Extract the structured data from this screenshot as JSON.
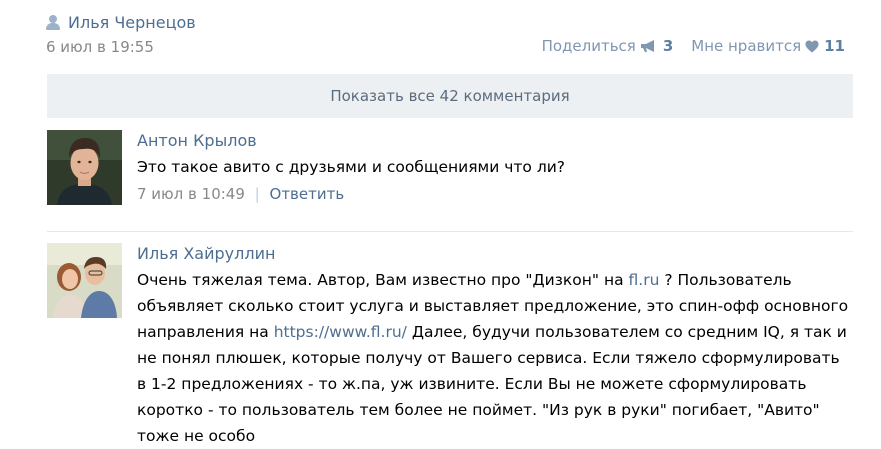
{
  "post": {
    "author": "Илья Чернецов",
    "date": "6 июл в 19:55",
    "share_label": "Поделиться",
    "share_count": "3",
    "like_label": "Мне нравится",
    "like_count": "11"
  },
  "show_all_label": "Показать все 42 комментария",
  "comments": [
    {
      "author": "Антон Крылов",
      "text": "Это такое авито с друзьями и сообщениями что ли?",
      "date": "7 июл в 10:49",
      "separator": "|",
      "reply_label": "Ответить"
    },
    {
      "author": "Илья Хайруллин",
      "text_1": "Очень тяжелая тема. Автор, Вам известно про \"Дизкон\" на ",
      "link_1": "fl.ru",
      "text_2": " ? Пользователь объявляет сколько стоит услуга и выставляет предложение, это спин-офф основного направления на ",
      "link_2": "https://www.fl.ru/",
      "text_3": " Далее, будучи пользователем со средним IQ, я так и не понял плюшек, которые получу от Вашего сервиса. Если тяжело сформулировать в 1-2 предложениях - то ж.па, уж извините. Если Вы не можете сформулировать коротко - то пользователь тем более не поймет. \"Из рук в руки\" погибает, \"Авито\" тоже не особо"
    }
  ],
  "colors": {
    "link": "#4d6e91",
    "muted": "#888888",
    "show_all_bg": "#edf0f3"
  },
  "icons": [
    "user-icon",
    "megaphone-icon",
    "heart-icon"
  ]
}
